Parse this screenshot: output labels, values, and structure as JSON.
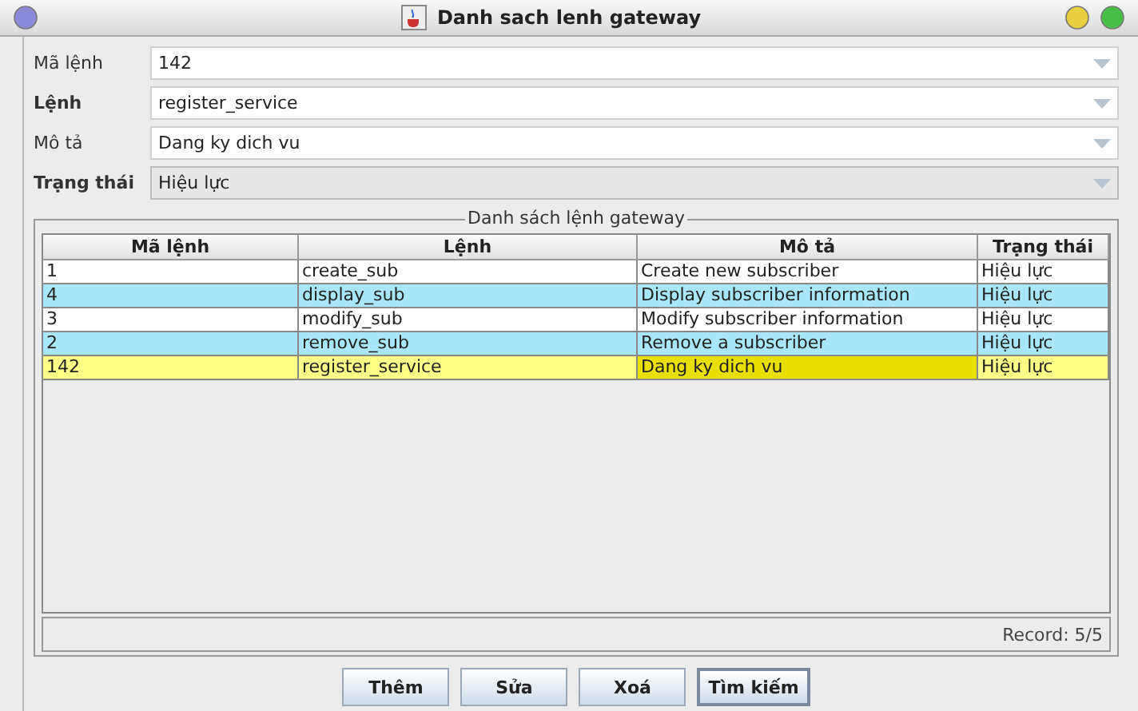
{
  "window": {
    "title": "Danh sach lenh gateway"
  },
  "fields": [
    {
      "label": "Mã lệnh",
      "value": "142",
      "emphasized": false,
      "disabled": false
    },
    {
      "label": "Lệnh",
      "value": "register_service",
      "emphasized": true,
      "disabled": false
    },
    {
      "label": "Mô tả",
      "value": "Dang ky dich vu",
      "emphasized": false,
      "disabled": false
    },
    {
      "label": "Trạng thái",
      "value": "Hiệu lực",
      "emphasized": true,
      "disabled": true
    }
  ],
  "group": {
    "title": "Danh sách lệnh gateway"
  },
  "table": {
    "columns": [
      "Mã lệnh",
      "Lệnh",
      "Mô tả",
      "Trạng thái"
    ],
    "rows": [
      {
        "selected": false,
        "cells": [
          {
            "text": "1",
            "focused": false
          },
          {
            "text": "create_sub",
            "focused": false
          },
          {
            "text": "Create new subscriber",
            "focused": false
          },
          {
            "text": "Hiệu lực",
            "focused": false
          }
        ]
      },
      {
        "selected": false,
        "cells": [
          {
            "text": "4",
            "focused": false
          },
          {
            "text": "display_sub",
            "focused": false
          },
          {
            "text": "Display subscriber information",
            "focused": false
          },
          {
            "text": "Hiệu lực",
            "focused": false
          }
        ]
      },
      {
        "selected": false,
        "cells": [
          {
            "text": "3",
            "focused": false
          },
          {
            "text": "modify_sub",
            "focused": false
          },
          {
            "text": "Modify subscriber information",
            "focused": false
          },
          {
            "text": "Hiệu lực",
            "focused": false
          }
        ]
      },
      {
        "selected": false,
        "cells": [
          {
            "text": "2",
            "focused": false
          },
          {
            "text": "remove_sub",
            "focused": false
          },
          {
            "text": "Remove a subscriber",
            "focused": false
          },
          {
            "text": "Hiệu lực",
            "focused": false
          }
        ]
      },
      {
        "selected": true,
        "cells": [
          {
            "text": "142",
            "focused": false
          },
          {
            "text": "register_service",
            "focused": false
          },
          {
            "text": "Dang ky dich vu",
            "focused": true
          },
          {
            "text": "Hiệu lực",
            "focused": false
          }
        ]
      }
    ]
  },
  "status": "Record: 5/5",
  "buttons": [
    {
      "label": "Thêm",
      "focused": false
    },
    {
      "label": "Sửa",
      "focused": false
    },
    {
      "label": "Xoá",
      "focused": false
    },
    {
      "label": "Tìm kiếm",
      "focused": true
    }
  ]
}
